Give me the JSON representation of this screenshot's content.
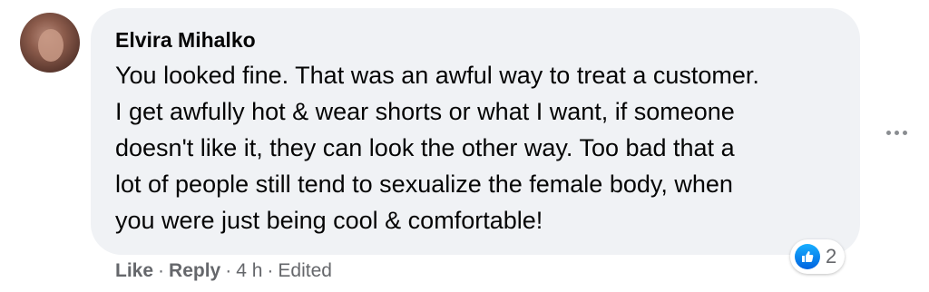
{
  "comment": {
    "author": "Elvira Mihalko",
    "lines": [
      "You looked fine. That was an awful way to treat a customer.",
      "I get awfully hot & wear shorts or what I want, if someone",
      "doesn't like it, they can look the other way. Too bad that a",
      "lot of people still tend to sexualize the female body, when",
      "you were just being cool & comfortable!"
    ],
    "reaction_icon": "like-icon",
    "reaction_count": "2",
    "actions": {
      "like": "Like",
      "reply": "Reply",
      "time": "4 h",
      "edited": "Edited",
      "separator": "·"
    },
    "more_icon": "more-options-icon"
  },
  "colors": {
    "bubble": "#f0f2f5",
    "text": "#050505",
    "muted": "#65676b",
    "like_blue": "#0571ed"
  }
}
